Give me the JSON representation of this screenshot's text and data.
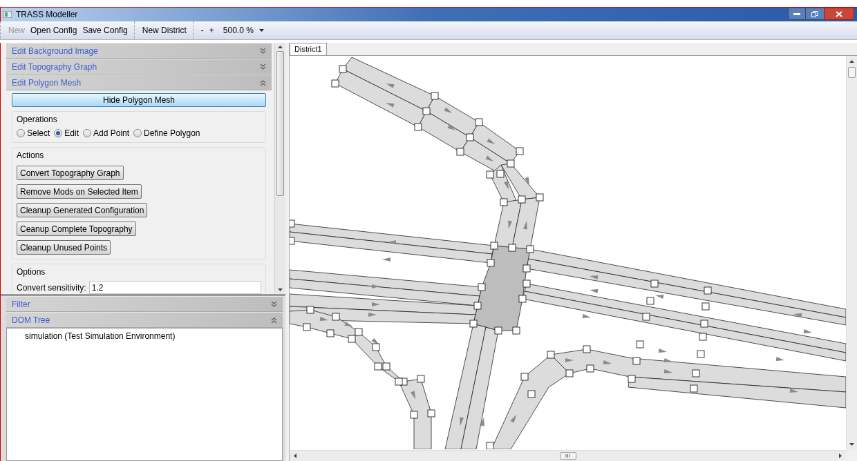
{
  "window": {
    "title": "TRASS Modeller"
  },
  "toolbar": {
    "groups": [
      [
        {
          "label": "New",
          "disabled": true
        },
        {
          "label": "Open Config",
          "disabled": false
        },
        {
          "label": "Save Config",
          "disabled": false
        }
      ],
      [
        {
          "label": "New District",
          "disabled": false
        }
      ],
      [
        {
          "label": "-",
          "disabled": false
        },
        {
          "label": "+",
          "disabled": false
        }
      ]
    ],
    "zoom_value": "500.0 %"
  },
  "sections": [
    {
      "title": "Edit Background Image",
      "expanded": false
    },
    {
      "title": "Edit Topography Graph",
      "expanded": false
    },
    {
      "title": "Edit Polygon Mesh",
      "expanded": true
    }
  ],
  "polygon_mesh": {
    "toggle_button": "Hide Polygon Mesh",
    "operations": {
      "title": "Operations",
      "options": [
        {
          "label": "Select",
          "selected": false
        },
        {
          "label": "Edit",
          "selected": true
        },
        {
          "label": "Add Point",
          "selected": false
        },
        {
          "label": "Define Polygon",
          "selected": false
        }
      ]
    },
    "actions": {
      "title": "Actions",
      "buttons": [
        "Convert Topography Graph",
        "Remove Mods on Selected Item",
        "Cleanup Generated Configuration",
        "Ceanup Complete Topography",
        "Cleanup Unused Points"
      ]
    },
    "options": {
      "title": "Options",
      "fields": [
        {
          "label": "Convert sensitivity:",
          "value": "1.2"
        }
      ]
    }
  },
  "bottom_sections": [
    {
      "title": "Filter",
      "expanded": false
    },
    {
      "title": "DOM Tree",
      "expanded": true
    }
  ],
  "dom_tree": [
    {
      "label": "simulation (Test Simulation Environment)"
    }
  ],
  "tabs": [
    {
      "label": "District1",
      "selected": true
    }
  ]
}
